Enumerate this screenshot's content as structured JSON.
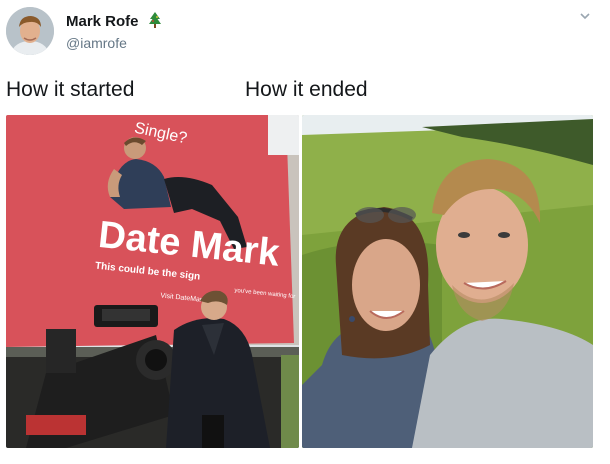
{
  "tweet": {
    "author_name": "Mark Rofe",
    "author_emoji": "tree-emoji-icon",
    "author_handle": "@iamrofe",
    "caption_left": "How it started",
    "caption_right": "How it ended"
  },
  "billboard": {
    "headline_top": "Single?",
    "headline": "Date Mark",
    "subline": "This could be the sign",
    "subline_tail": "you've been waiting for",
    "footer": "Visit DateMark"
  },
  "colors": {
    "billboard_red": "#d8525a",
    "grass_green": "#7ea23c",
    "sky": "#e8eef0",
    "handle_gray": "#657786"
  }
}
